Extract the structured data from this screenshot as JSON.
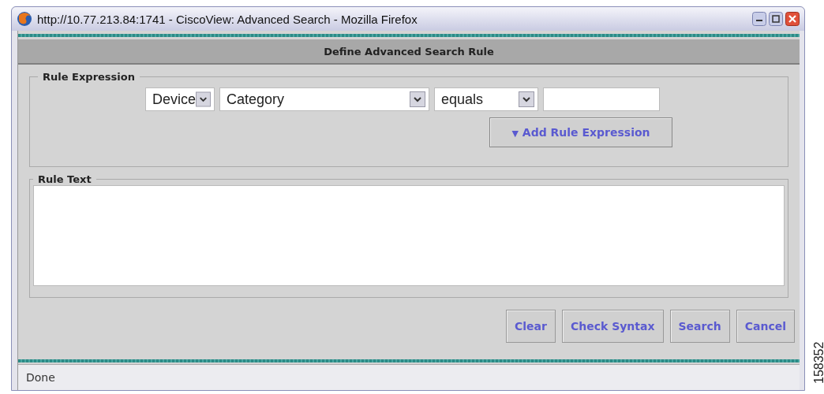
{
  "window": {
    "title": "http://10.77.213.84:1741 - CiscoView: Advanced Search - Mozilla Firefox"
  },
  "header": {
    "title": "Define Advanced Search Rule"
  },
  "rule_expression": {
    "legend": "Rule Expression",
    "dropdowns": [
      {
        "value": "Device"
      },
      {
        "value": "Category"
      },
      {
        "value": "equals"
      }
    ],
    "add_button": {
      "icon": "▼",
      "label": "Add Rule Expression"
    }
  },
  "rule_text": {
    "legend": "Rule Text"
  },
  "buttons": [
    "Clear",
    "Check Syntax",
    "Search",
    "Cancel"
  ],
  "status_bar": {
    "text": "Done"
  },
  "figure_number": "158352"
}
